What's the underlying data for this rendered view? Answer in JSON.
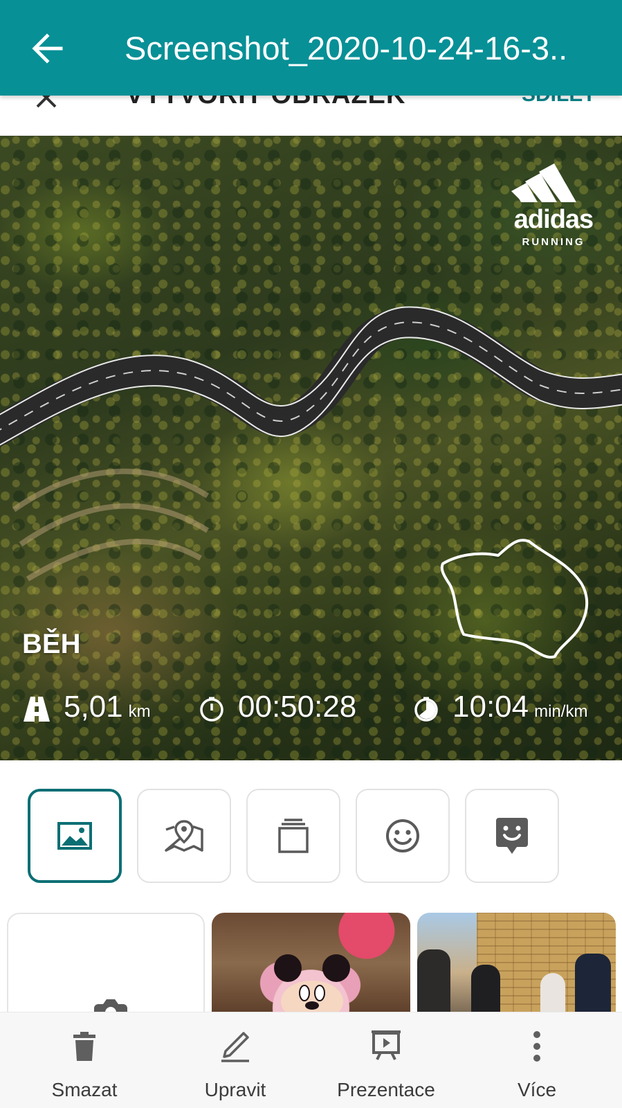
{
  "app_bar": {
    "title": "Screenshot_2020-10-24-16-3..",
    "back_icon": "arrow-back-icon",
    "background": "#079096"
  },
  "underlying_header": {
    "title": "VYTVOŘIT OBRÁZEK",
    "share_label": "SDÍLET"
  },
  "activity_card": {
    "brand": {
      "word": "adidas",
      "sub": "RUNNING"
    },
    "activity_type": "BĚH",
    "stats": [
      {
        "icon": "road-icon",
        "value": "5,01",
        "unit": "km"
      },
      {
        "icon": "stopwatch-icon",
        "value": "00:50:28",
        "unit": ""
      },
      {
        "icon": "pace-icon",
        "value": "10:04",
        "unit": "min/km"
      }
    ]
  },
  "templates": [
    {
      "icon": "image-icon",
      "selected": true
    },
    {
      "icon": "map-pin-icon",
      "selected": false
    },
    {
      "icon": "layers-icon",
      "selected": false
    },
    {
      "icon": "smiley-icon",
      "selected": false
    },
    {
      "icon": "sticker-icon",
      "selected": false
    }
  ],
  "gallery": [
    {
      "type": "camera",
      "icon": "camera-icon"
    },
    {
      "type": "photo",
      "subject": "cake"
    },
    {
      "type": "photo",
      "subject": "street"
    }
  ],
  "bottom_actions": [
    {
      "icon": "trash-icon",
      "label": "Smazat"
    },
    {
      "icon": "pencil-icon",
      "label": "Upravit"
    },
    {
      "icon": "slideshow-icon",
      "label": "Prezentace"
    },
    {
      "icon": "more-vert-icon",
      "label": "Více"
    }
  ],
  "colors": {
    "accent": "#079096",
    "selected_border": "#0a6f74",
    "icon_gray": "#5a5a5a"
  }
}
